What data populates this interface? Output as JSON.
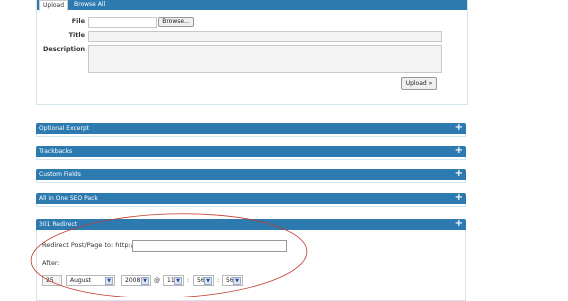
{
  "upload": {
    "tabs": [
      {
        "label": "Upload"
      },
      {
        "label": "Browse All"
      }
    ],
    "file_label": "File",
    "browse_label": "Browse...",
    "title_label": "Title",
    "description_label": "Description",
    "upload_button": "Upload »"
  },
  "sections": [
    {
      "label": "Optional Excerpt",
      "toggle": "+"
    },
    {
      "label": "Trackbacks",
      "toggle": "+"
    },
    {
      "label": "Custom Fields",
      "toggle": "+"
    },
    {
      "label": "All in One SEO Pack",
      "toggle": "+"
    }
  ],
  "redirect": {
    "title": "301 Redirect",
    "toggle": "+",
    "prompt": "Redirect Post/Page to: http://",
    "after_label": "After:",
    "day": "25",
    "month": "August",
    "year": "2008",
    "at": "@",
    "hour": "11",
    "minute": "56",
    "second": "56",
    "sep1": ":",
    "sep2": ":"
  },
  "annotation_color": "#c0392b"
}
